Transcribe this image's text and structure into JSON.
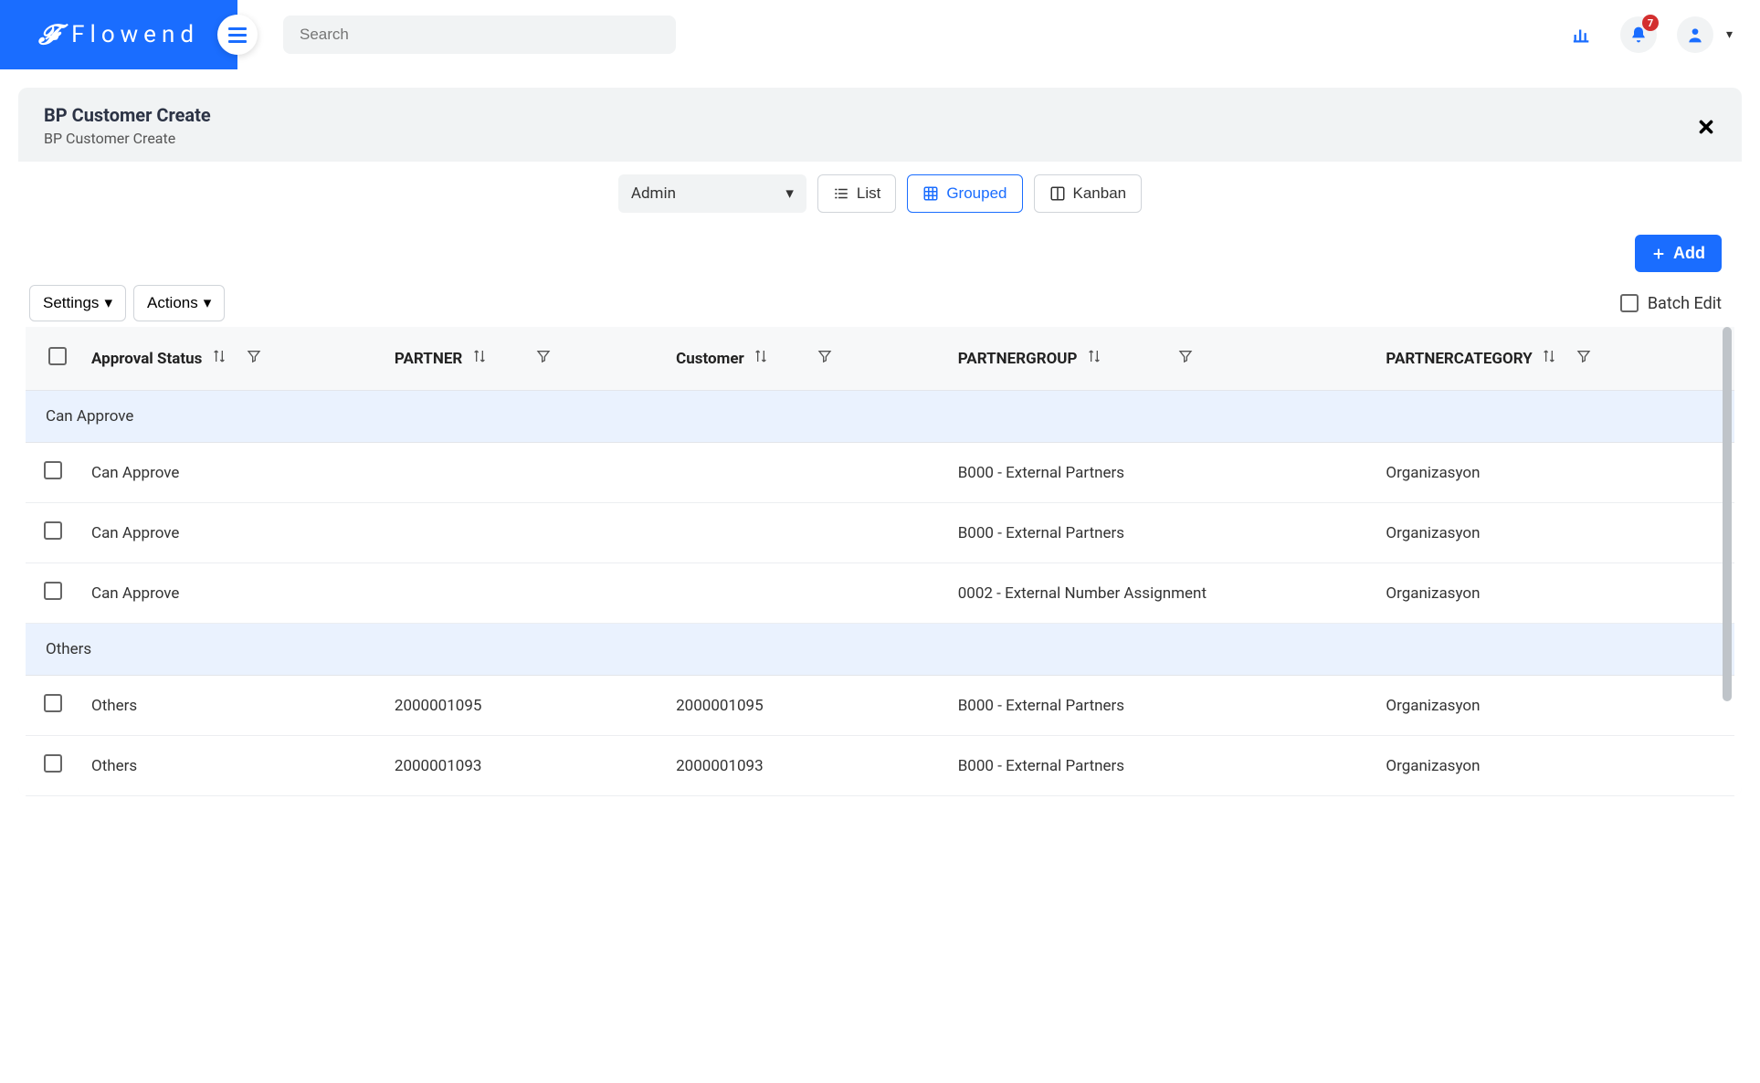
{
  "brand": {
    "name": "Flowend"
  },
  "search": {
    "placeholder": "Search"
  },
  "notifications": {
    "count": "7"
  },
  "page": {
    "title": "BP Customer Create",
    "subtitle": "BP Customer Create"
  },
  "toolbar": {
    "admin_label": "Admin",
    "view_list": "List",
    "view_grouped": "Grouped",
    "view_kanban": "Kanban",
    "add_label": "Add",
    "settings_label": "Settings",
    "actions_label": "Actions",
    "batch_edit_label": "Batch Edit"
  },
  "columns": {
    "approval": "Approval Status",
    "partner": "PARTNER",
    "customer": "Customer",
    "partnergroup": "PARTNERGROUP",
    "partnercategory": "PARTNERCATEGORY"
  },
  "groups": [
    {
      "label": "Can Approve",
      "rows": [
        {
          "approval": "Can Approve",
          "partner": "",
          "customer": "",
          "partnergroup": "B000 - External Partners",
          "partnercategory": "Organizasyon"
        },
        {
          "approval": "Can Approve",
          "partner": "",
          "customer": "",
          "partnergroup": "B000 - External Partners",
          "partnercategory": "Organizasyon"
        },
        {
          "approval": "Can Approve",
          "partner": "",
          "customer": "",
          "partnergroup": "0002 - External Number Assignment",
          "partnercategory": "Organizasyon"
        }
      ]
    },
    {
      "label": "Others",
      "rows": [
        {
          "approval": "Others",
          "partner": "2000001095",
          "customer": "2000001095",
          "partnergroup": "B000 - External Partners",
          "partnercategory": "Organizasyon"
        },
        {
          "approval": "Others",
          "partner": "2000001093",
          "customer": "2000001093",
          "partnergroup": "B000 - External Partners",
          "partnercategory": "Organizasyon"
        }
      ]
    }
  ]
}
